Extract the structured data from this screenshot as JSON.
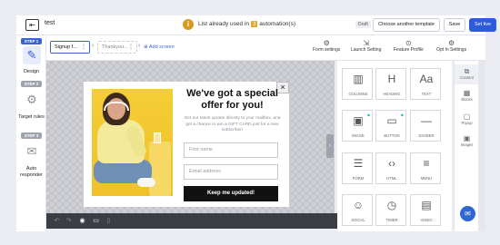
{
  "header": {
    "title": "test",
    "used_prefix": "List already used in",
    "used_count": "3",
    "used_suffix": "automation(s)",
    "status": "Draft",
    "choose_template": "Choose another template",
    "save": "Save",
    "set_live": "Set live"
  },
  "steps": [
    {
      "tag": "STEP 1",
      "label": "Design",
      "icon": "paint-brush-icon"
    },
    {
      "tag": "STEP 2",
      "label": "Target rules",
      "icon": "target-gear-icon"
    },
    {
      "tag": "STEP 3",
      "label": "Auto responder",
      "icon": "auto-responder-icon"
    }
  ],
  "screens": {
    "tabs": [
      "Signup f...",
      "Thankyou..."
    ],
    "add": "Add screen"
  },
  "toolbar": [
    "Form settings",
    "Launch Setting",
    "Feature Profile",
    "Opt In Settings"
  ],
  "popup": {
    "title": "We've got a special offer for you!",
    "description": "Get our latest update directly to your mailbox, and get a chance to win a GIFT CARD just for a new subscriber!",
    "first_name_placeholder": "First name",
    "email_placeholder": "Email address",
    "cta": "Keep me updated!",
    "close": "×"
  },
  "elements": [
    {
      "label": "COLUMNS",
      "icon": "columns-icon"
    },
    {
      "label": "HEADING",
      "icon": "heading-icon"
    },
    {
      "label": "TEXT",
      "icon": "text-icon"
    },
    {
      "label": "IMAGE",
      "icon": "image-icon"
    },
    {
      "label": "BUTTON",
      "icon": "button-icon"
    },
    {
      "label": "DIVIDER",
      "icon": "divider-icon"
    },
    {
      "label": "FORM",
      "icon": "form-icon"
    },
    {
      "label": "HTML",
      "icon": "html-icon"
    },
    {
      "label": "MENU",
      "icon": "menu-icon"
    },
    {
      "label": "SOCIAL",
      "icon": "social-icon"
    },
    {
      "label": "TIMER",
      "icon": "timer-icon"
    },
    {
      "label": "VIDEO",
      "icon": "video-icon"
    }
  ],
  "right_sidebar": [
    "Content",
    "Blocks",
    "Popup",
    "Images"
  ],
  "colors": {
    "accent": "#2e5bd9",
    "badge": "#e2a52d"
  }
}
